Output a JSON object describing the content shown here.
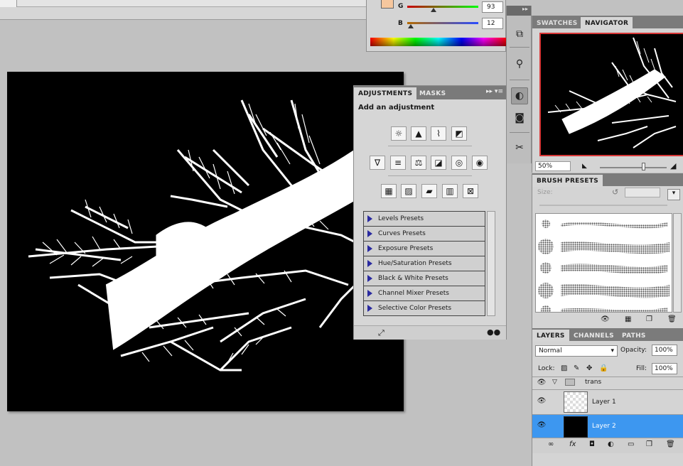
{
  "color_panel": {
    "g_label": "G",
    "g_value": "93",
    "g_fraction": 0.365,
    "b_label": "B",
    "b_value": "12",
    "b_fraction": 0.047,
    "fg_color": "#f6c79e"
  },
  "adjustments": {
    "tabs": [
      "ADJUSTMENTS",
      "MASKS"
    ],
    "title": "Add an adjustment",
    "presets": [
      "Levels Presets",
      "Curves Presets",
      "Exposure Presets",
      "Hue/Saturation Presets",
      "Black & White Presets",
      "Channel Mixer Presets",
      "Selective Color Presets"
    ],
    "icons_row1": [
      "brightness-contrast-icon",
      "levels-icon",
      "curves-icon",
      "exposure-icon"
    ],
    "icons_row2": [
      "vibrance-icon",
      "hue-saturation-icon",
      "color-balance-icon",
      "black-white-icon",
      "photo-filter-icon",
      "channel-mixer-icon"
    ],
    "icons_row3": [
      "invert-icon",
      "posterize-icon",
      "threshold-icon",
      "gradient-map-icon",
      "selective-color-icon"
    ]
  },
  "navigator": {
    "tabs": [
      "SWATCHES",
      "NAVIGATOR"
    ],
    "zoom": "50%",
    "zoom_fraction": 0.65
  },
  "brush_presets": {
    "title": "BRUSH PRESETS",
    "size_label": "Size:"
  },
  "layers": {
    "tabs": [
      "LAYERS",
      "CHANNELS",
      "PATHS"
    ],
    "blend_mode": "Normal",
    "opacity_label": "Opacity:",
    "opacity_value": "100%",
    "lock_label": "Lock:",
    "fill_label": "Fill:",
    "fill_value": "100%",
    "group_name": "trans",
    "layer1_name": "Layer 1",
    "layer2_name": "Layer 2"
  },
  "colors": {
    "selection": "#3d97f0",
    "navigator_frame": "#d73737"
  }
}
